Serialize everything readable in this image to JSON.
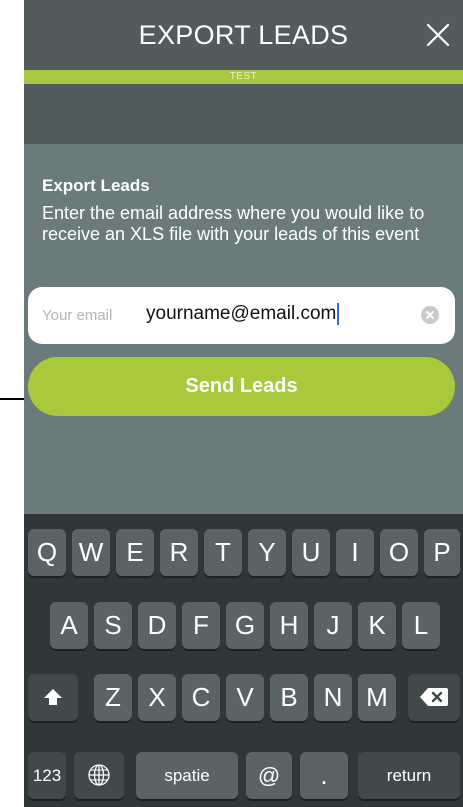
{
  "header": {
    "title": "EXPORT LEADS",
    "env_badge": "TEST"
  },
  "export": {
    "title": "Export Leads",
    "description": "Enter the email address where you would like to receive an XLS file with your leads of this event",
    "email_label": "Your email",
    "email_value": "yourname@email.com",
    "send_label": "Send Leads"
  },
  "keyboard": {
    "row1": [
      "Q",
      "W",
      "E",
      "R",
      "T",
      "Y",
      "U",
      "I",
      "O",
      "P"
    ],
    "row2": [
      "A",
      "S",
      "D",
      "F",
      "G",
      "H",
      "J",
      "K",
      "L"
    ],
    "row3": [
      "Z",
      "X",
      "C",
      "V",
      "B",
      "N",
      "M"
    ],
    "numbers_label": "123",
    "space_label": "spatie",
    "at_label": "@",
    "dot_label": ".",
    "return_label": "return"
  },
  "colors": {
    "accent_green": "#a8c93c",
    "header_bg": "#525c5c",
    "content_bg": "#6b7b7b",
    "keyboard_bg": "#2f3738"
  }
}
